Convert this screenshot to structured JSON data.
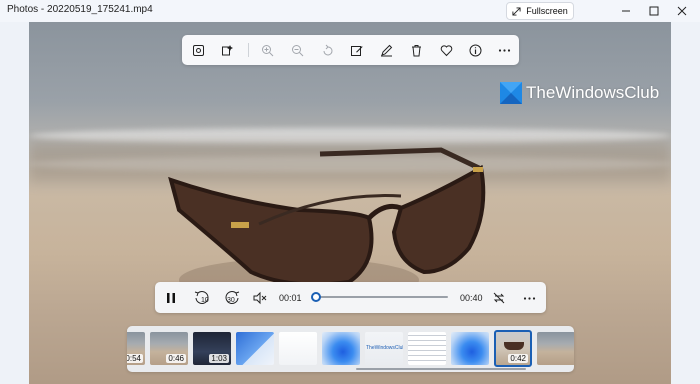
{
  "window": {
    "title": "Photos - 20220519_175241.mp4",
    "fullscreen_label": "Fullscreen",
    "controls": [
      "minimize-icon",
      "maximize-icon",
      "close-icon"
    ]
  },
  "toolbar": {
    "buttons": [
      {
        "name": "view-original-icon"
      },
      {
        "name": "visual-search-icon"
      },
      {
        "name": "zoom-in-icon",
        "disabled": true
      },
      {
        "name": "zoom-out-icon",
        "disabled": true
      },
      {
        "name": "rotate-icon",
        "disabled": true
      },
      {
        "name": "edit-image-icon"
      },
      {
        "name": "draw-icon"
      },
      {
        "name": "delete-icon"
      },
      {
        "name": "favorite-icon"
      },
      {
        "name": "file-info-icon"
      },
      {
        "name": "more-options-icon"
      }
    ]
  },
  "watermark": {
    "text": "TheWindowsClub",
    "accent": "#1e88e5"
  },
  "playback": {
    "current_time": "00:01",
    "total_time": "00:40",
    "progress": 0.025,
    "buttons": [
      "pause-icon",
      "rewind-10-icon",
      "forward-30-icon",
      "mute-icon",
      "repeat-off-icon",
      "more-options-icon"
    ],
    "rewind_label": "10",
    "forward_label": "30"
  },
  "filmstrip": {
    "items": [
      {
        "duration": "0:54",
        "theme": "beach"
      },
      {
        "duration": "0:46",
        "theme": "beach"
      },
      {
        "duration": "1:03",
        "theme": "dark"
      },
      {
        "duration": "",
        "theme": "blue-ui"
      },
      {
        "duration": "",
        "theme": "white-ui"
      },
      {
        "duration": "",
        "theme": "win11"
      },
      {
        "duration": "",
        "theme": "thewindowsclub"
      },
      {
        "duration": "",
        "theme": "spreadsheet"
      },
      {
        "duration": "",
        "theme": "win11"
      },
      {
        "duration": "0:42",
        "theme": "sunglasses",
        "selected": true
      },
      {
        "duration": "",
        "theme": "beach"
      }
    ],
    "thumbnail_wc_text": "TheWindowsClub",
    "accent": "#1a5fb4"
  }
}
